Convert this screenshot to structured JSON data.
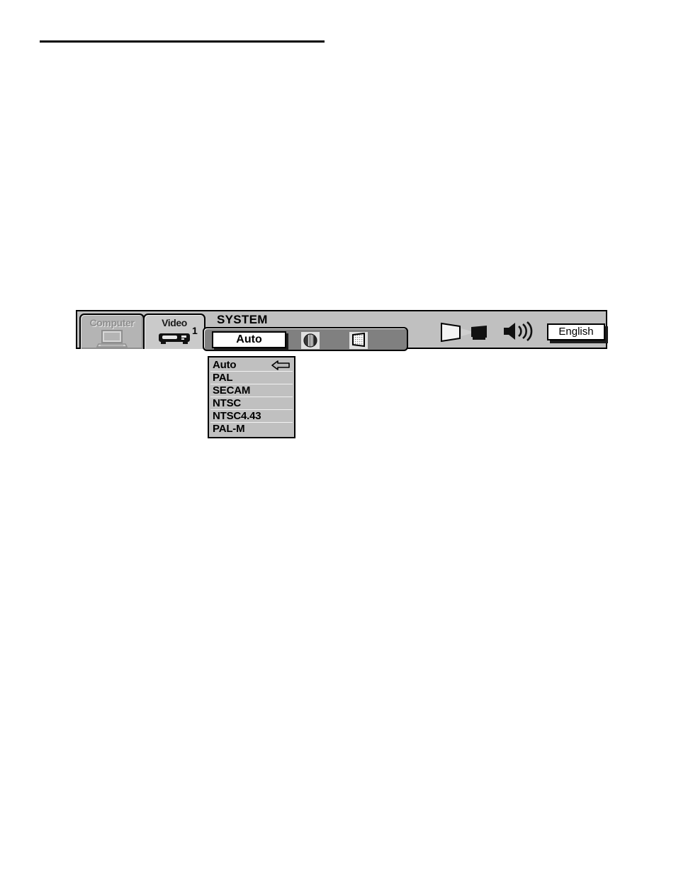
{
  "page": {
    "background": "#ffffff",
    "rule_color": "#000000"
  },
  "osd": {
    "bar_background": "#c0c0c0",
    "group_background": "#808080",
    "source_tabs": [
      {
        "label": "Computer",
        "icon": "laptop-icon",
        "state": "inactive"
      },
      {
        "label": "Video",
        "icon": "vcr-icon",
        "state": "active",
        "number": "1"
      }
    ],
    "system": {
      "title": "SYSTEM",
      "selected_value": "Auto",
      "icons": [
        {
          "name": "image-adjust-icon"
        },
        {
          "name": "screen-keystone-icon"
        }
      ]
    },
    "right_icons": [
      {
        "name": "projector-screen-icon"
      },
      {
        "name": "sound-volume-icon"
      }
    ],
    "language_button": {
      "label": "English"
    }
  },
  "dropdown": {
    "pointer_icon": "left-arrow-icon",
    "items": [
      {
        "label": "Auto",
        "selected": true
      },
      {
        "label": "PAL",
        "selected": false
      },
      {
        "label": "SECAM",
        "selected": false
      },
      {
        "label": "NTSC",
        "selected": false
      },
      {
        "label": "NTSC4.43",
        "selected": false
      },
      {
        "label": "PAL-M",
        "selected": false
      }
    ]
  }
}
